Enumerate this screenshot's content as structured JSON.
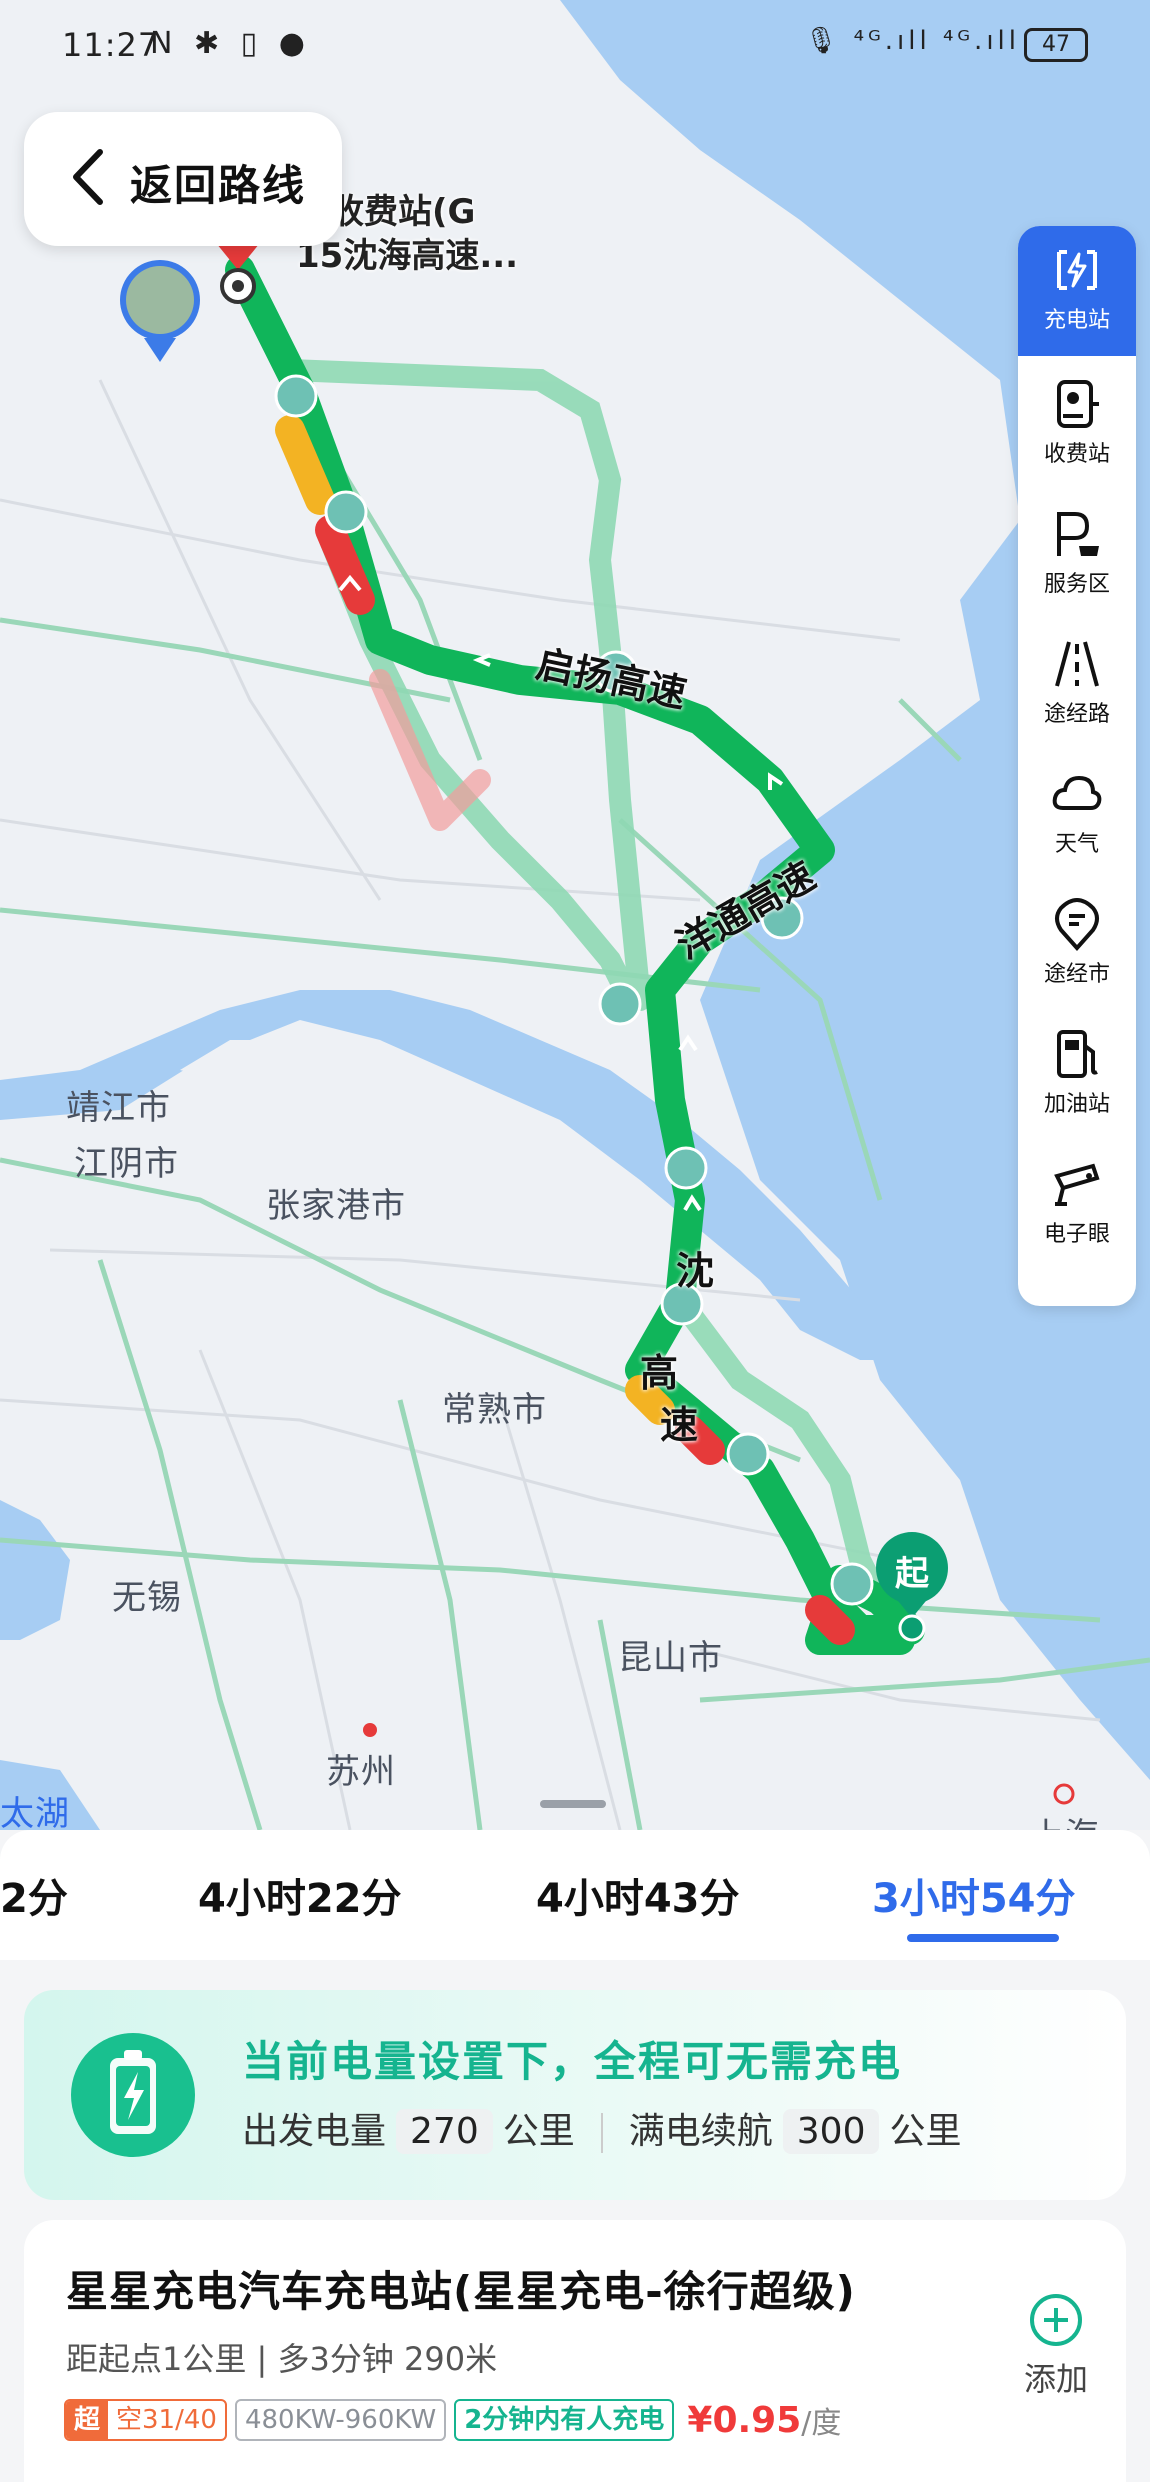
{
  "status_bar": {
    "time": "11:27",
    "left_icons": "N ✱ ▯ ●",
    "right_icons": "🎙 ⁴ᴳ.ıll ⁴ᴳ.ıll",
    "battery": "47"
  },
  "header": {
    "back_label": "返回路线"
  },
  "map": {
    "destination_name_line1": "台收费站(G",
    "destination_name_line2": "15沈海高速...",
    "city_labels": {
      "jingjiang": "靖江市",
      "jiangyin": "江阴市",
      "zhangjiagang": "张家港市",
      "changshu": "常熟市",
      "wuxi": "无锡",
      "kunshan": "昆山市",
      "suzhou": "苏州",
      "taihu": "太湖",
      "shanghai": "上海"
    },
    "road_labels": {
      "qixie": "启扬高速",
      "yangtong": "洋通高速",
      "shen": "沈",
      "gaosu": "高",
      "su": "速"
    },
    "start_marker": "起"
  },
  "toolbar": {
    "items": [
      {
        "label": "充电站",
        "icon": "charging-station-icon"
      },
      {
        "label": "收费站",
        "icon": "toll-station-icon"
      },
      {
        "label": "服务区",
        "icon": "service-area-icon"
      },
      {
        "label": "途经路",
        "icon": "road-icon"
      },
      {
        "label": "天气",
        "icon": "weather-icon"
      },
      {
        "label": "途经市",
        "icon": "city-icon"
      },
      {
        "label": "加油站",
        "icon": "gas-station-icon"
      },
      {
        "label": "电子眼",
        "icon": "camera-icon"
      }
    ]
  },
  "routes": {
    "tabs": [
      "2分",
      "4小时22分",
      "4小时43分",
      "3小时54分"
    ],
    "active_index": 3
  },
  "battery_card": {
    "title": "当前电量设置下，全程可无需充电",
    "depart_label": "出发电量",
    "depart_value": "270",
    "depart_unit": "公里",
    "full_label": "满电续航",
    "full_value": "300",
    "full_unit": "公里"
  },
  "station": {
    "name": "星星充电汽车充电站(星星充电-徐行超级)",
    "distance": "距起点1公里 | 多3分钟 290米",
    "super_tag": "超",
    "availability": "空31/40",
    "power": "480KW-960KW",
    "occupancy": "2分钟内有人充电",
    "price": "¥0.95",
    "price_unit": "/度",
    "add_label": "添加"
  },
  "colors": {
    "accent": "#2f6bea",
    "route_green": "#10b55a",
    "alt_route": "#8fd9b4",
    "water": "#a7cdf3",
    "charge_green": "#15b48f",
    "price_red": "#f03a3a"
  }
}
